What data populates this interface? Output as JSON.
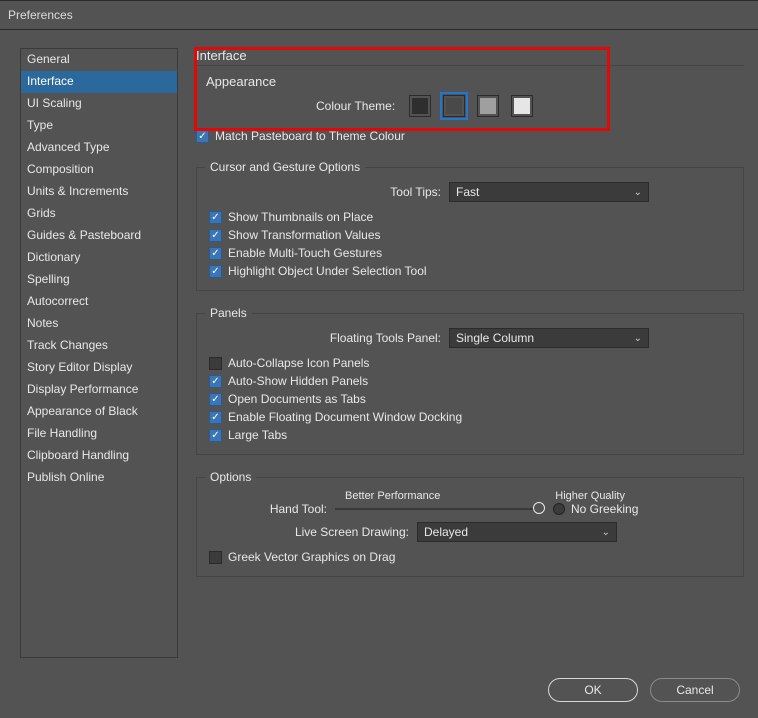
{
  "window_title": "Preferences",
  "sidebar": {
    "selected_index": 1,
    "items": [
      "General",
      "Interface",
      "UI Scaling",
      "Type",
      "Advanced Type",
      "Composition",
      "Units & Increments",
      "Grids",
      "Guides & Pasteboard",
      "Dictionary",
      "Spelling",
      "Autocorrect",
      "Notes",
      "Track Changes",
      "Story Editor Display",
      "Display Performance",
      "Appearance of Black",
      "File Handling",
      "Clipboard Handling",
      "Publish Online"
    ]
  },
  "interface": {
    "heading": "Interface",
    "appearance_heading": "Appearance",
    "colour_theme_label": "Colour Theme:",
    "swatches": [
      {
        "color": "#2e2e2e",
        "selected": false
      },
      {
        "color": "#494949",
        "selected": true
      },
      {
        "color": "#9f9f9f",
        "selected": false
      },
      {
        "color": "#e6e6e6",
        "selected": false
      }
    ],
    "match_pasteboard": {
      "checked": true,
      "label": "Match Pasteboard to Theme Colour"
    }
  },
  "cursor": {
    "legend": "Cursor and Gesture Options",
    "tooltips_label": "Tool Tips:",
    "tooltips_value": "Fast",
    "checks": [
      {
        "checked": true,
        "label": "Show Thumbnails on Place"
      },
      {
        "checked": true,
        "label": "Show Transformation Values"
      },
      {
        "checked": true,
        "label": "Enable Multi-Touch Gestures"
      },
      {
        "checked": true,
        "label": "Highlight Object Under Selection Tool"
      }
    ]
  },
  "panels": {
    "legend": "Panels",
    "floating_label": "Floating Tools Panel:",
    "floating_value": "Single Column",
    "checks": [
      {
        "checked": false,
        "label": "Auto-Collapse Icon Panels"
      },
      {
        "checked": true,
        "label": "Auto-Show Hidden Panels"
      },
      {
        "checked": true,
        "label": "Open Documents as Tabs"
      },
      {
        "checked": true,
        "label": "Enable Floating Document Window Docking"
      },
      {
        "checked": true,
        "label": "Large Tabs"
      }
    ]
  },
  "options": {
    "legend": "Options",
    "better_perf": "Better Performance",
    "higher_quality": "Higher Quality",
    "hand_tool_label": "Hand Tool:",
    "no_greeking": "No Greeking",
    "live_screen_label": "Live Screen Drawing:",
    "live_screen_value": "Delayed",
    "greek_vector": {
      "checked": false,
      "label": "Greek Vector Graphics on Drag"
    }
  },
  "buttons": {
    "ok": "OK",
    "cancel": "Cancel"
  }
}
